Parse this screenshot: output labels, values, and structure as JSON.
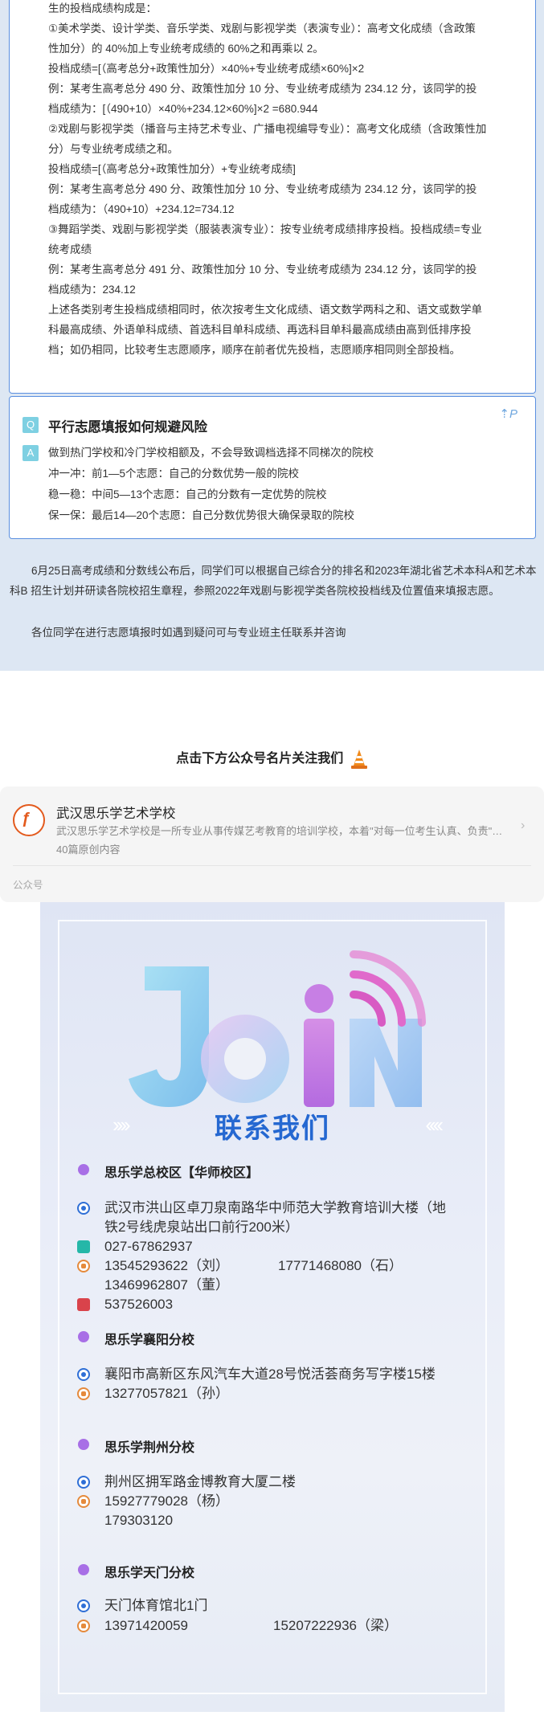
{
  "article": {
    "box1_lines": [
      "生的投档成绩构成是：",
      "①美术学类、设计学类、音乐学类、戏剧与影视学类（表演专业）：高考文化成绩（含政策",
      "性加分）的 40%加上专业统考成绩的 60%之和再乘以 2。",
      "投档成绩=[（高考总分+政策性加分）×40%+专业统考成绩×60%]×2",
      "例：某考生高考总分 490 分、政策性加分 10 分、专业统考成绩为 234.12 分，该同学的投",
      "档成绩为：[（490+10）×40%+234.12×60%]×2 =680.944",
      "②戏剧与影视学类（播音与主持艺术专业、广播电视编导专业）：高考文化成绩（含政策性加",
      "分）与专业统考成绩之和。",
      "投档成绩=[（高考总分+政策性加分）+专业统考成绩]",
      "例：某考生高考总分 490 分、政策性加分 10 分、专业统考成绩为 234.12 分，该同学的投",
      "档成绩为：（490+10）+234.12=734.12",
      "③舞蹈学类、戏剧与影视学类（服装表演专业）：按专业统考成绩排序投档。投档成绩=专业",
      "统考成绩",
      "例：某考生高考总分 491 分、政策性加分 10 分、专业统考成绩为 234.12 分，该同学的投",
      "档成绩为：234.12",
      "上述各类别考生投档成绩相同时，依次按考生文化成绩、语文数学两科之和、语文或数学单",
      "科最高成绩、外语单科成绩、首选科目单科成绩、再选科目单科最高成绩由高到低排序投",
      "档；如仍相同，比较考生志愿顺序，顺序在前者优先投档，志愿顺序相同则全部投档。"
    ],
    "qa": {
      "q_badge": "Q",
      "a_badge": "A",
      "corner_mark": "⇡P",
      "question": "平行志愿填报如何规避风险",
      "answers": [
        "做到热门学校和冷门学校相额及，不会导致调档选择不同梯次的院校",
        "冲一冲：前1—5个志愿：自己的分数优势一般的院校",
        "稳一稳：中间5—13个志愿：自己的分数有一定优势的院校",
        "保一保：最后14—20个志愿：自己分数优势很大确保录取的院校"
      ]
    },
    "closing_paragraph": "6月25日高考成绩和分数线公布后，同学们可以根据自己综合分的排名和2023年湖北省艺术本科A和艺术本科B 招生计划并研读各院校招生章程，参照2022年戏剧与影视学类各院校投档线及位置值来填报志愿。",
    "closing_line": "各位同学在进行志愿填报时如遇到疑问可与专业班主任联系并咨询"
  },
  "follow_prompt": "点击下方公众号名片关注我们",
  "account_card": {
    "name": "武汉思乐学艺术学校",
    "description": "武汉思乐学艺术学校是一所专业从事传媒艺考教育的培训学校，本着\"对每一位考生认真、负责\"的理念",
    "article_count": "40篇原创内容",
    "tag": "公众号",
    "arrow": "›"
  },
  "poster": {
    "join_word": "JOIN",
    "title": "联系我们",
    "chevrons_left": "››››",
    "chevrons_right": "‹‹‹‹",
    "campuses": [
      {
        "name": "思乐学总校区【华师校区】",
        "address": "武汉市洪山区卓刀泉南路华中师范大学教育培训大楼（地",
        "address_cont": "铁2号线虎泉站出口前行200米）",
        "tel": "027-67862937",
        "phone1": "13545293622（刘）",
        "phone2": "17771468080（石）",
        "phone3": "13469962807（董）",
        "qq": "537526003"
      },
      {
        "name": "思乐学襄阳分校",
        "address": "襄阳市高新区东风汽车大道28号悦活荟商务写字楼15楼",
        "phone1": "13277057821（孙）"
      },
      {
        "name": "思乐学荆州分校",
        "address": "荆州区拥军路金博教育大厦二楼",
        "phone1": "15927779028（杨）",
        "phone2": "179303120"
      },
      {
        "name": "思乐学天门分校",
        "address": "天门体育馆北1门",
        "phone1": "13971420059",
        "phone2": "15207222936（梁）"
      }
    ]
  },
  "colors": {
    "accent_blue": "#2568d1",
    "box_border": "#5a8fe0",
    "campus_dot": "#a86fe6",
    "page_bg_top": "#dde7f3"
  }
}
